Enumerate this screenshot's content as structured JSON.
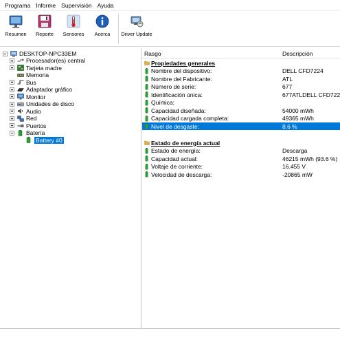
{
  "menu": [
    "Programa",
    "Informe",
    "Supervisión",
    "Ayuda"
  ],
  "toolbar": [
    {
      "label": "Resumen",
      "icon": "monitor-icon"
    },
    {
      "label": "Reporte",
      "icon": "floppy-disk-icon"
    },
    {
      "label": "Sensores",
      "icon": "thermometer-icon"
    },
    {
      "label": "Acerca",
      "icon": "info-icon"
    },
    {
      "label": "Driver Update",
      "icon": "driver-update-icon"
    }
  ],
  "tree": {
    "root": "DESKTOP-NPC33EM",
    "items": [
      "Procesador(es) central",
      "Tarjeta madre",
      "Memoria",
      "Bus",
      "Adaptador gráfico",
      "Monitor",
      "Unidades de disco",
      "Audio",
      "Red",
      "Puertos",
      "Batería"
    ],
    "selected_child": "Battery #0"
  },
  "columns": {
    "name": "Rasgo",
    "value": "Descripción"
  },
  "sections": [
    {
      "title": "Propiedades generales",
      "rows": [
        {
          "name": "Nombre del dispositivo:",
          "value": "DELL CFD7224"
        },
        {
          "name": "Nombre del Fabricante:",
          "value": "ATL"
        },
        {
          "name": "Número de serie:",
          "value": "677"
        },
        {
          "name": "Identificación única:",
          "value": "677ATLDELL CFD7224"
        },
        {
          "name": "Química:",
          "value": ""
        },
        {
          "name": "Capacidad diseñada:",
          "value": "54000 mWh"
        },
        {
          "name": "Capacidad cargada completa:",
          "value": "49365 mWh"
        },
        {
          "name": "Nivel de desgaste:",
          "value": "8.6 %"
        }
      ]
    },
    {
      "title": "Estado de energía actual",
      "rows": [
        {
          "name": "Estado de energía:",
          "value": "Descarga"
        },
        {
          "name": "Capacidad actual:",
          "value": "46215 mWh (93.6 %)"
        },
        {
          "name": "Voltaje de corriente:",
          "value": "16.455 V"
        },
        {
          "name": "Velocidad de descarga:",
          "value": "-20865 mW"
        }
      ]
    }
  ],
  "colors": {
    "selection": "#0078d7",
    "battery_green": "#2e9e3a"
  }
}
